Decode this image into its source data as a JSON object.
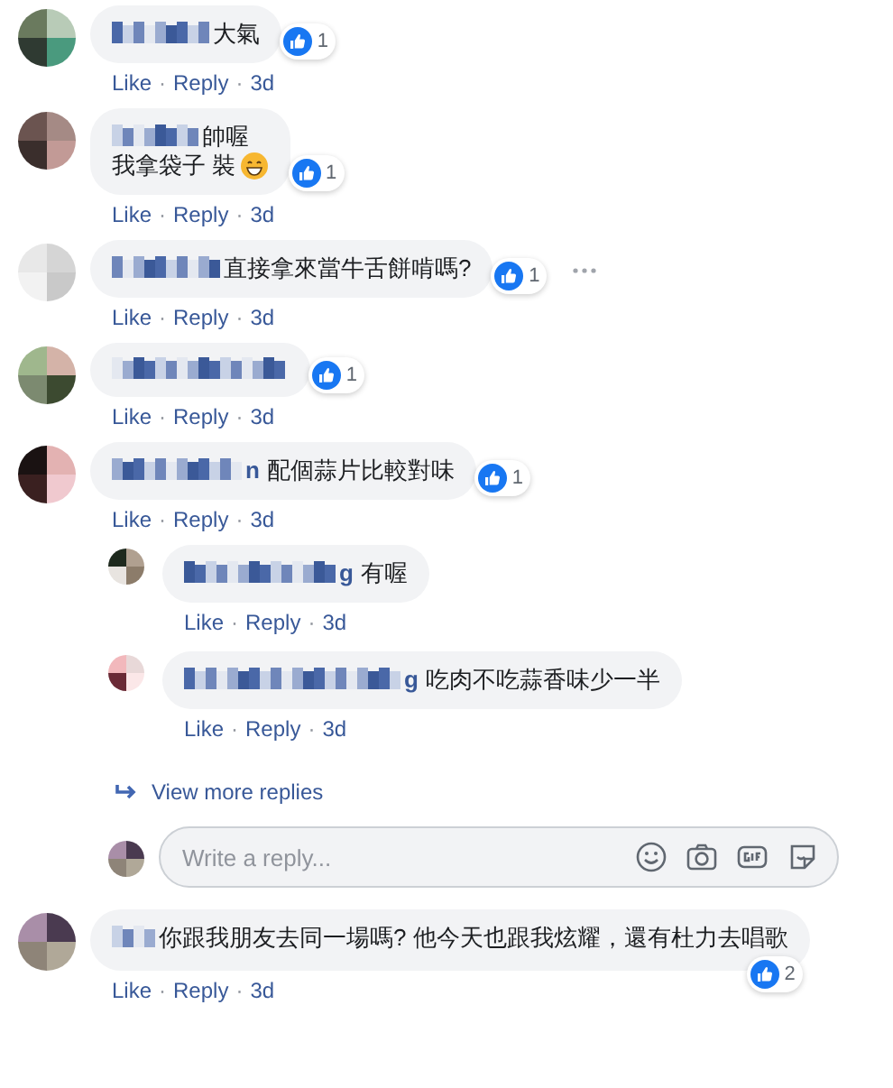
{
  "separator": "·",
  "comments": [
    {
      "lines": [
        "大氣"
      ],
      "likes": "1",
      "actions": [
        "Like",
        "Reply",
        "3d"
      ]
    },
    {
      "lines": [
        "帥喔",
        "我拿袋子 裝"
      ],
      "emoji": true,
      "likes": "1",
      "actions": [
        "Like",
        "Reply",
        "3d"
      ]
    },
    {
      "lines": [
        "直接拿來當牛舌餅啃嗎?"
      ],
      "likes": "1",
      "options": true,
      "actions": [
        "Like",
        "Reply",
        "3d"
      ]
    },
    {
      "likes": "1",
      "actions": [
        "Like",
        "Reply",
        "3d"
      ]
    },
    {
      "name_tail": "n",
      "lines": [
        "配個蒜片比較對味"
      ],
      "likes": "1",
      "actions": [
        "Like",
        "Reply",
        "3d"
      ],
      "replies": [
        {
          "name_tail": "g",
          "lines": [
            "有喔"
          ],
          "actions": [
            "Like",
            "Reply",
            "3d"
          ]
        },
        {
          "name_tail": "g",
          "lines": [
            "吃肉不吃蒜香味少一半"
          ],
          "actions": [
            "Like",
            "Reply",
            "3d"
          ]
        }
      ],
      "more_replies": "View more replies",
      "reply_placeholder": "Write a reply..."
    },
    {
      "lines": [
        "你跟我朋友去同一場嗎? 他今天也跟我炫耀，還有杜力去唱歌"
      ],
      "likes": "2",
      "badge_below": true,
      "actions": [
        "Like",
        "Reply",
        "3d"
      ]
    }
  ]
}
